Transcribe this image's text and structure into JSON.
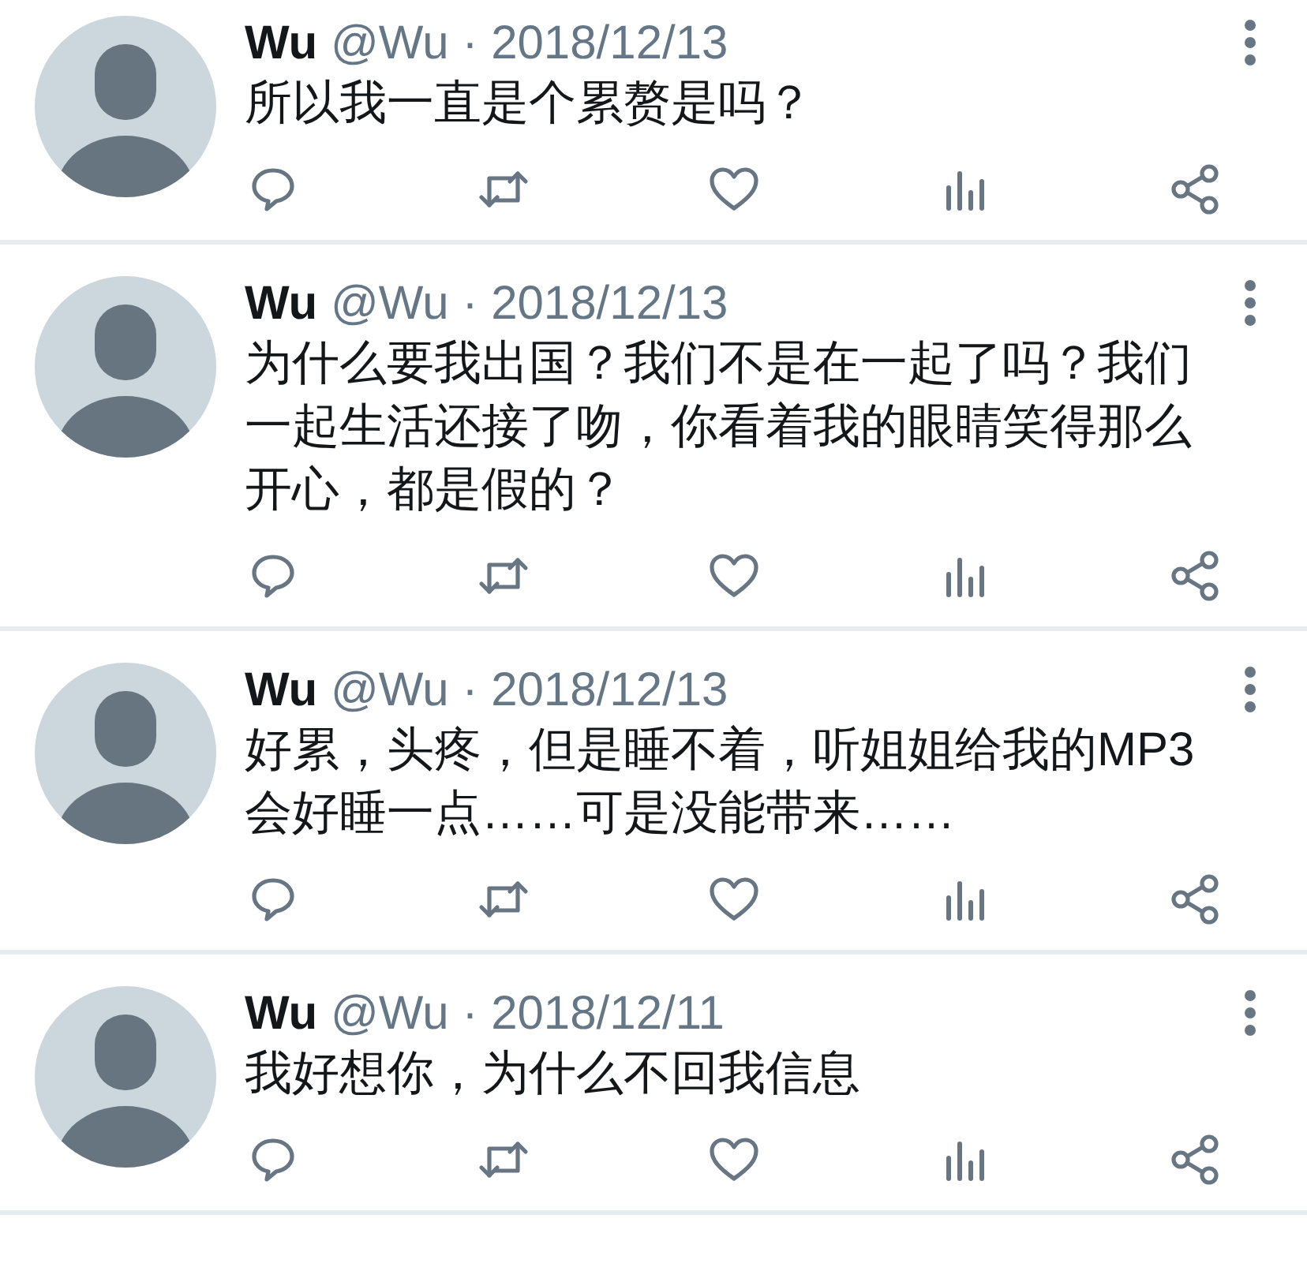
{
  "tweets": [
    {
      "name": "Wu",
      "handle": "@Wu",
      "separator": "·",
      "date": "2018/12/13",
      "lines": [
        "所以我一直是个累赘是吗？"
      ]
    },
    {
      "name": "Wu",
      "handle": "@Wu",
      "separator": "·",
      "date": "2018/12/13",
      "lines": [
        "为什么要我出国？我们不是在一起了吗？我们",
        "一起生活还接了吻，你看着我的眼睛笑得那么",
        "开心，都是假的？"
      ]
    },
    {
      "name": "Wu",
      "handle": "@Wu",
      "separator": "·",
      "date": "2018/12/13",
      "lines": [
        "好累，头疼，但是睡不着，听姐姐给我的MP3",
        "会好睡一点……可是没能带来……"
      ]
    },
    {
      "name": "Wu",
      "handle": "@Wu",
      "separator": "·",
      "date": "2018/12/11",
      "lines": [
        "我好想你，为什么不回我信息"
      ]
    }
  ]
}
